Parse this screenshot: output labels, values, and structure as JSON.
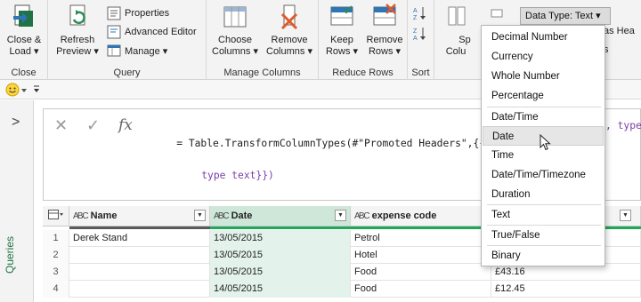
{
  "ribbon": {
    "close_group": {
      "btn_line1": "Close &",
      "btn_line2": "Load ▾",
      "label": "Close"
    },
    "query_group": {
      "refresh_line1": "Refresh",
      "refresh_line2": "Preview ▾",
      "properties": "Properties",
      "advanced_editor": "Advanced Editor",
      "manage": "Manage ▾",
      "label": "Query"
    },
    "manage_columns_group": {
      "choose_line1": "Choose",
      "choose_line2": "Columns ▾",
      "remove_line1": "Remove",
      "remove_line2": "Columns ▾",
      "label": "Manage Columns"
    },
    "reduce_rows_group": {
      "keep_line1": "Keep",
      "keep_line2": "Rows ▾",
      "remove_line1": "Remove",
      "remove_line2": "Rows ▾",
      "label": "Reduce Rows"
    },
    "sort_group": {
      "label": "Sort"
    },
    "transform_group": {
      "split_partial": "Sp",
      "colu_partial": "Colu",
      "as_hea_partial": "as Hea",
      "s_partial": "s"
    },
    "data_type_button": "Data Type: Text ▾"
  },
  "left_panel": {
    "queries_label": "Queries",
    "expand": ">"
  },
  "formula_bar": {
    "cancel": "✕",
    "commit": "✓",
    "fx": "fx",
    "line1": "= Table.TransformColumnTypes(#\"Promoted Headers\",{{\"N",
    "line1_tail": ", type",
    "line2": "type text}})"
  },
  "grid": {
    "type_prefix": "A B C",
    "columns": [
      "Name",
      "Date",
      "expense code",
      ""
    ],
    "rows": [
      {
        "num": "1",
        "name": "Derek Stand",
        "date": "13/05/2015",
        "code": "Petrol",
        "amount": ""
      },
      {
        "num": "2",
        "name": "",
        "date": "13/05/2015",
        "code": "Hotel",
        "amount": ""
      },
      {
        "num": "3",
        "name": "",
        "date": "13/05/2015",
        "code": "Food",
        "amount": "£43.16"
      },
      {
        "num": "4",
        "name": "",
        "date": "14/05/2015",
        "code": "Food",
        "amount": "£12.45"
      }
    ]
  },
  "data_type_menu": {
    "items": [
      "Decimal Number",
      "Currency",
      "Whole Number",
      "Percentage",
      "Date/Time",
      "Date",
      "Time",
      "Date/Time/Timezone",
      "Duration",
      "Text",
      "True/False",
      "Binary"
    ],
    "hovered": "Date"
  },
  "colors": {
    "accent": "#217346",
    "quality_bar": "#1fa85a",
    "selected_header": "#cfe7d9"
  }
}
